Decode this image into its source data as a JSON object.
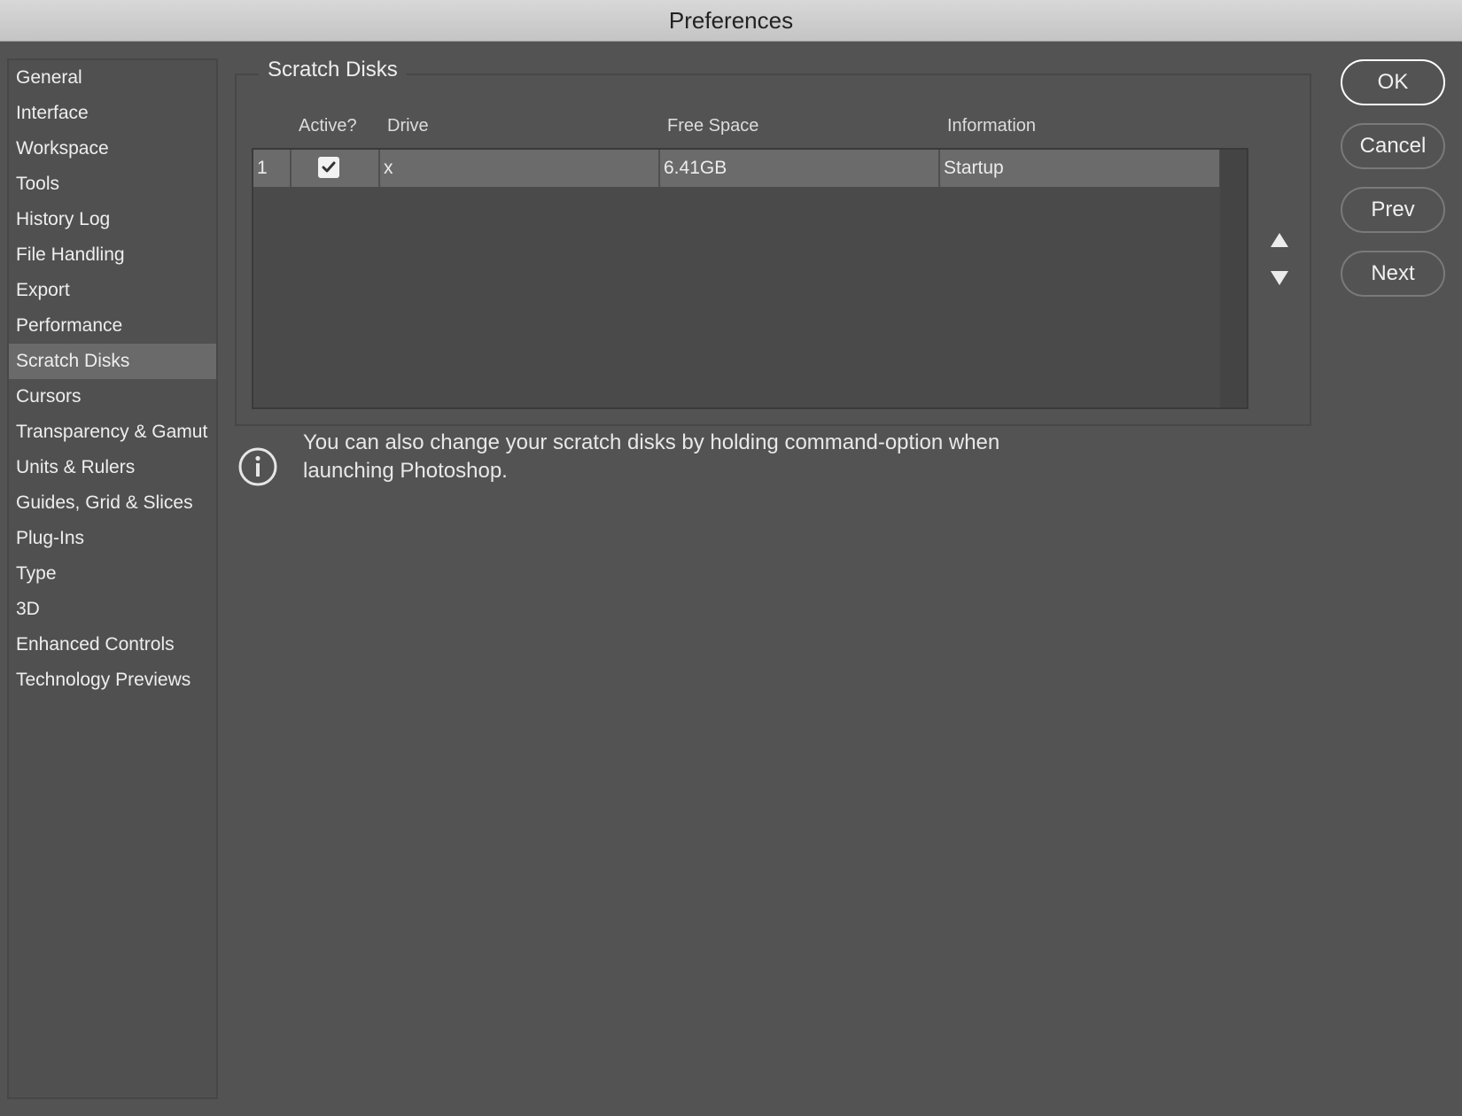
{
  "window": {
    "title": "Preferences"
  },
  "sidebar": {
    "selected": "Scratch Disks",
    "items": [
      {
        "label": "General"
      },
      {
        "label": "Interface"
      },
      {
        "label": "Workspace"
      },
      {
        "label": "Tools"
      },
      {
        "label": "History Log"
      },
      {
        "label": "File Handling"
      },
      {
        "label": "Export"
      },
      {
        "label": "Performance"
      },
      {
        "label": "Scratch Disks"
      },
      {
        "label": "Cursors"
      },
      {
        "label": "Transparency & Gamut"
      },
      {
        "label": "Units & Rulers"
      },
      {
        "label": "Guides, Grid & Slices"
      },
      {
        "label": "Plug-Ins"
      },
      {
        "label": "Type"
      },
      {
        "label": "3D"
      },
      {
        "label": "Enhanced Controls"
      },
      {
        "label": "Technology Previews"
      }
    ]
  },
  "scratch_disks": {
    "title": "Scratch Disks",
    "columns": {
      "active": "Active?",
      "drive": "Drive",
      "free_space": "Free Space",
      "information": "Information"
    },
    "rows": [
      {
        "index": "1",
        "active": true,
        "drive": "x",
        "free_space": "6.41GB",
        "information": "Startup"
      }
    ],
    "move_up_icon": "triangle-up-icon",
    "move_down_icon": "triangle-down-icon"
  },
  "info": {
    "icon": "info-icon",
    "text": "You can also change your scratch disks by holding command-option when launching Photoshop."
  },
  "buttons": {
    "ok": "OK",
    "cancel": "Cancel",
    "prev": "Prev",
    "next": "Next"
  }
}
